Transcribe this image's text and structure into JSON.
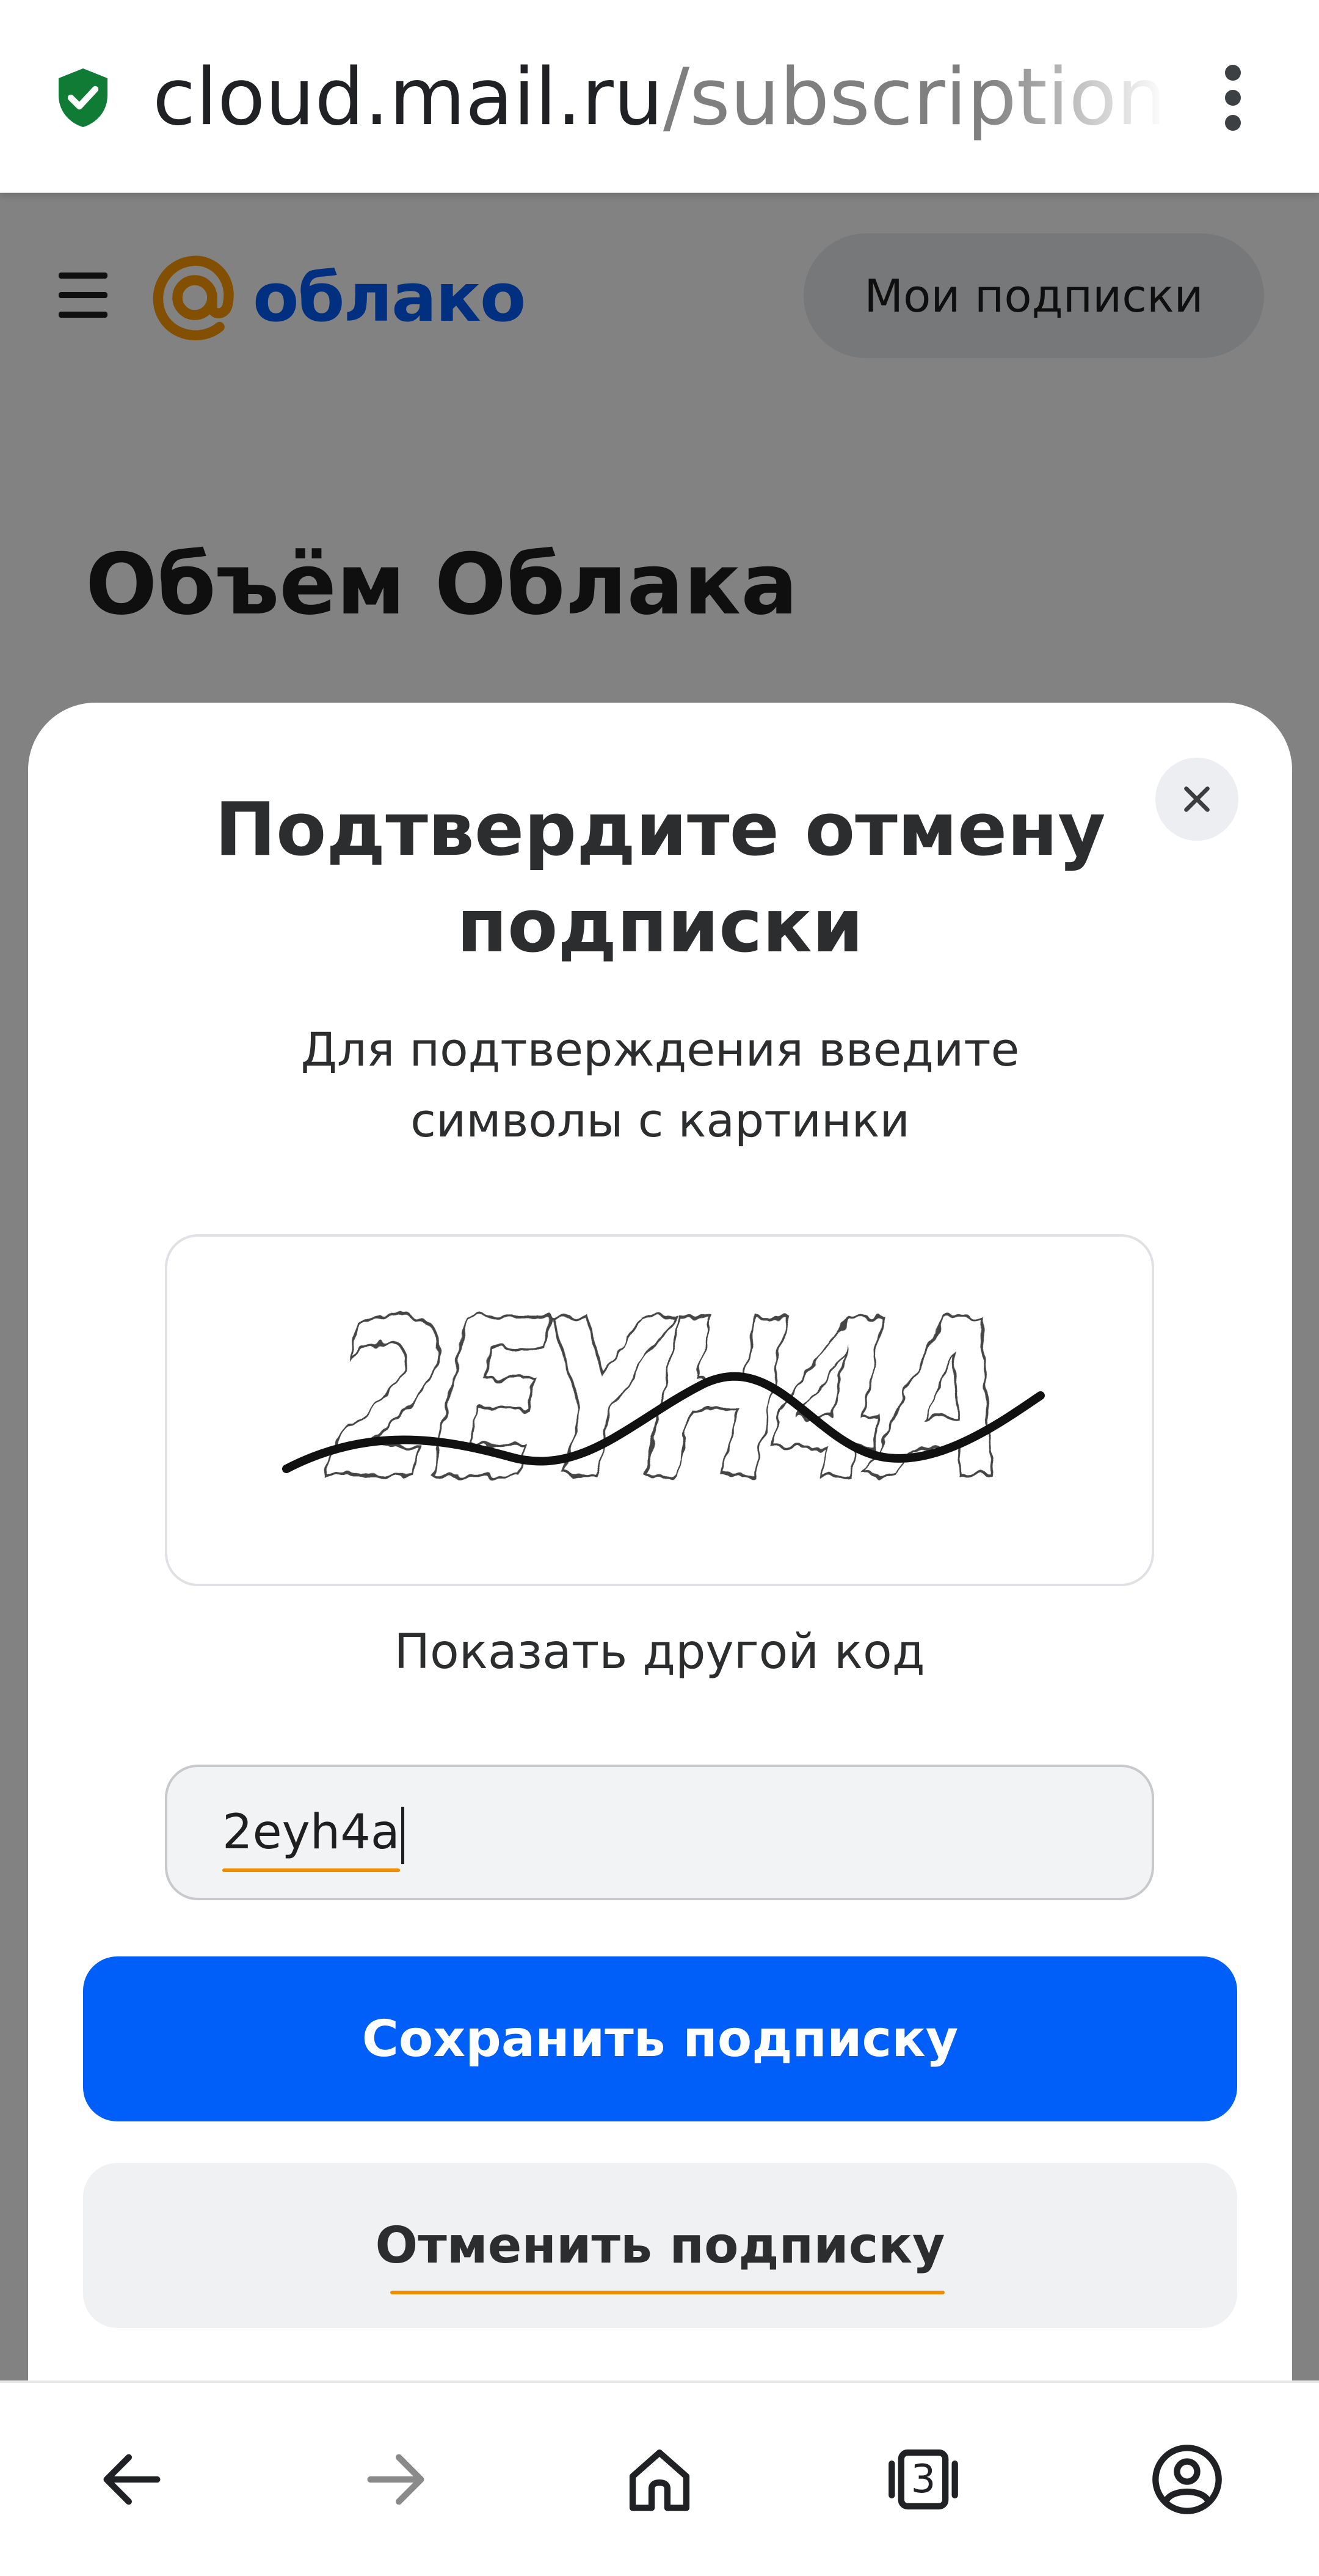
{
  "browser": {
    "url_host": "cloud.mail.ru",
    "url_path": "/subscriptions",
    "tab_count": "3",
    "icons": {
      "secure": "shield-check-icon",
      "menu": "kebab-menu-icon",
      "back": "arrow-left-icon",
      "forward": "arrow-right-icon",
      "home": "home-icon",
      "tabs": "tabs-icon",
      "account": "account-icon"
    }
  },
  "header": {
    "logo_text": "облако",
    "my_subscriptions_label": "Мои подписки"
  },
  "page": {
    "title": "Объём Облака"
  },
  "modal": {
    "title": "Подтвердите отмену подписки",
    "subtitle": "Для подтверждения введите символы с картинки",
    "captcha_text": "2EYH4A",
    "show_other_code_label": "Показать другой код",
    "code_input_value": "2eyh4a",
    "save_button_label": "Сохранить подписку",
    "cancel_button_label": "Отменить подписку"
  },
  "colors": {
    "brand_blue": "#005ff9",
    "brand_orange": "#ff9e00",
    "secure_green": "#0f7b35",
    "underline_orange": "#ef8c00",
    "overlay": "rgba(0,0,0,0.49)"
  }
}
